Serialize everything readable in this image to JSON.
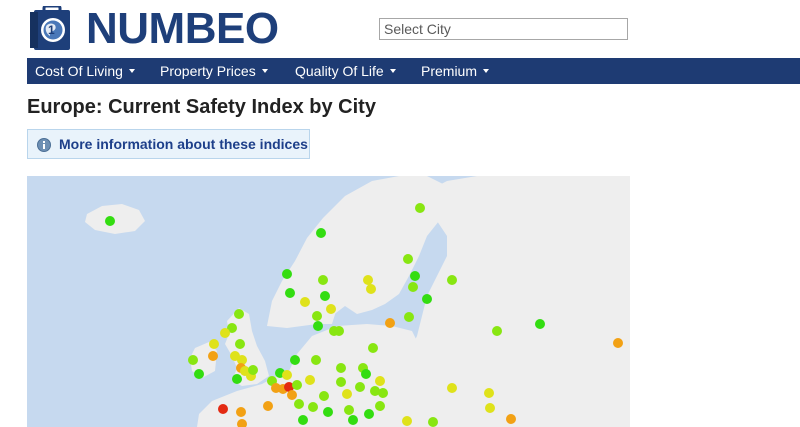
{
  "header": {
    "logo_text": "NUMBEO",
    "search": {
      "placeholder": "Select City",
      "value": ""
    }
  },
  "nav": {
    "items": [
      {
        "label": "Cost Of Living"
      },
      {
        "label": "Property Prices"
      },
      {
        "label": "Quality Of Life"
      },
      {
        "label": "Premium"
      }
    ]
  },
  "main": {
    "title": "Europe: Current Safety Index by City",
    "info_link": "More information about these indices"
  },
  "map": {
    "colors": {
      "water": "#c6d9ef",
      "land": "#eeeeee",
      "very_high": "#33dd11",
      "high": "#88e611",
      "medium": "#dfe21a",
      "low": "#f2a114",
      "very_low": "#e32a12"
    },
    "marker_levels": [
      "very_high",
      "high",
      "medium",
      "low",
      "very_low"
    ]
  }
}
